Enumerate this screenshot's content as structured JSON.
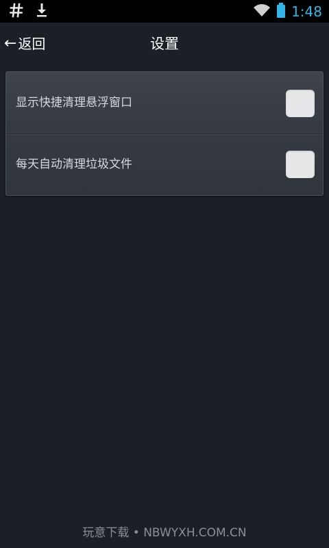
{
  "status_bar": {
    "left_icons": [
      "hash-icon",
      "download-icon"
    ],
    "right_icons": [
      "wifi-icon",
      "battery-icon"
    ],
    "time": "1:48",
    "accent_color": "#33b5e5"
  },
  "header": {
    "back_label": "返回",
    "back_arrow": "←",
    "title": "设置"
  },
  "settings": {
    "items": [
      {
        "label": "显示快捷清理悬浮窗口",
        "checked": false
      },
      {
        "label": "每天自动清理垃圾文件",
        "checked": false
      }
    ]
  },
  "watermark": {
    "text": "玩意下载 • NBWYXH.COM.CN"
  }
}
